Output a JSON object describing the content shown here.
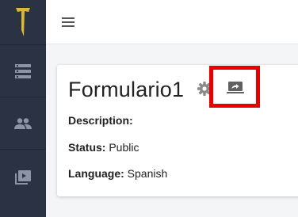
{
  "icons": {
    "logo": "t-logo-icon",
    "nav": [
      "storage-icon",
      "people-icon",
      "video-library-icon"
    ],
    "menu": "hamburger-icon",
    "settings": "gear-icon",
    "share": "screen-share-icon"
  },
  "colors": {
    "sidebar": "#2b3243",
    "logo": "#e0b62e",
    "nav_icon": "#8d94a3",
    "highlight": "#e60000"
  },
  "form": {
    "title": "Formulario1",
    "description_label": "Description:",
    "description_value": "",
    "status_label": "Status:",
    "status_value": "Public",
    "language_label": "Language:",
    "language_value": "Spanish"
  }
}
